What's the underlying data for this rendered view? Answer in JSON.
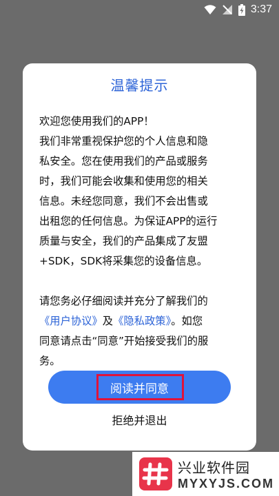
{
  "status_bar": {
    "time": "3:37",
    "icons": [
      "wifi-icon",
      "signal-muted-icon",
      "battery-charging-icon"
    ]
  },
  "dialog": {
    "title": "温馨提示",
    "paragraph1_lines": [
      "欢迎您使用我们的APP！",
      "我们非常重视保护您的个人信息和隐",
      "私安全。您在使用我们的产品或服务",
      "时，我们可能会收集和使用您的相关",
      "信息。未经您同意，我们不会出售或",
      "出租您的任何信息。为保证APP的运行",
      "质量与安全，我们的产品集成了友盟",
      "+SDK，SDK将采集您的设备信息。"
    ],
    "paragraph2": {
      "line1": "请您务必仔细阅读并充分了解我们的",
      "user_agreement_link": "《用户协议》",
      "and_text": "及",
      "privacy_policy_link": "《隐私政策》",
      "after_links": "。如您",
      "line3": "同意请点击“同意”开始接受我们的服",
      "line4": "务。"
    },
    "accept_label": "阅读并同意",
    "decline_label": "拒绝并退出"
  },
  "watermark": {
    "name": "兴业软件园",
    "domain": "MYXYJS.COM"
  },
  "colors": {
    "accent": "#2c63d7",
    "button": "#3d7cf0",
    "highlight": "#e0133a",
    "logo": "#e8344a"
  }
}
